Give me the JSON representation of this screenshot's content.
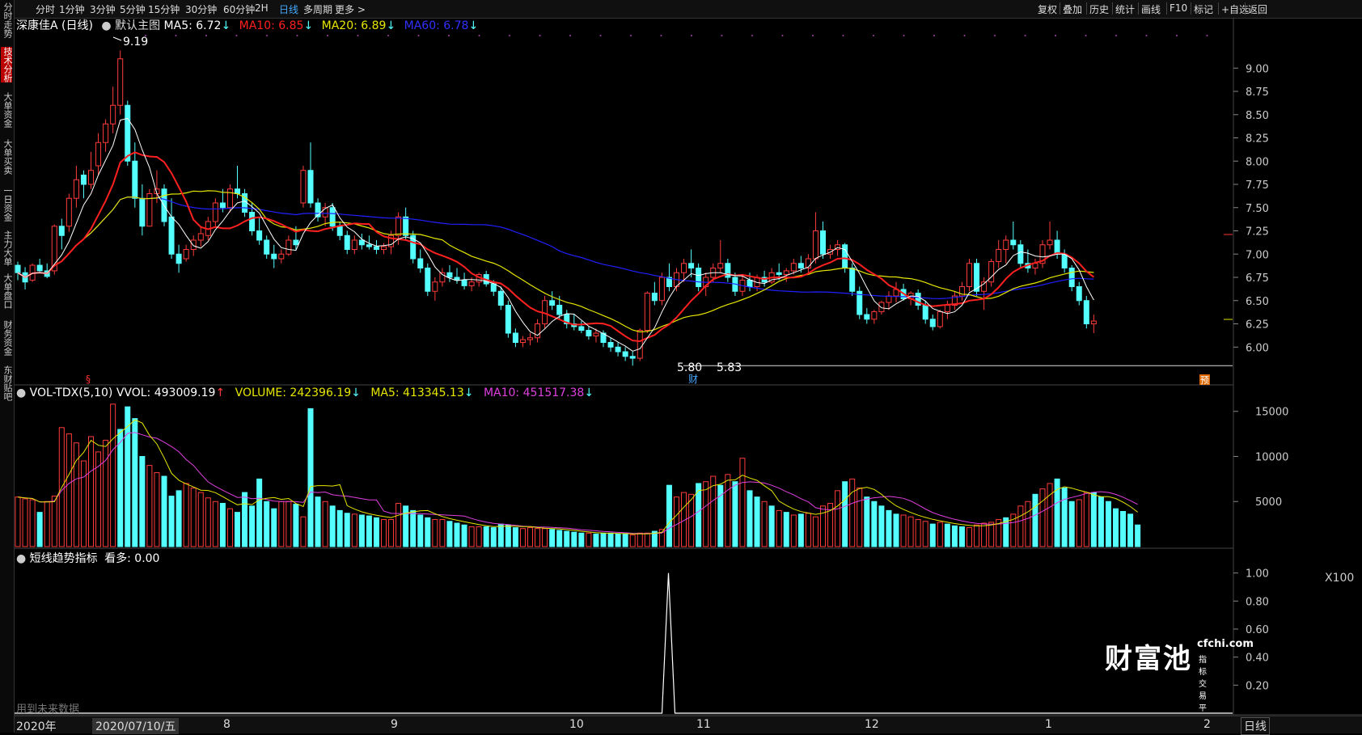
{
  "toolbar": {
    "left": [
      "分时",
      "1分钟",
      "3分钟",
      "5分钟",
      "15分钟",
      "30分钟",
      "60分钟",
      "2H",
      "日线",
      "多周期",
      "更多 >"
    ],
    "active": "日线",
    "right": [
      "复权",
      "叠加",
      "历史",
      "统计",
      "画线",
      "F10",
      "标记",
      "+自选",
      "返回"
    ]
  },
  "sidebar": [
    "分时走势",
    "技术分析",
    "大单资金",
    "大单买卖",
    "一日资金",
    "主力大单",
    "大单盘口",
    "财务资金",
    "东财贴吧"
  ],
  "sidebar_active": "技术分析",
  "main_header": {
    "stock": "深康佳A (日线)",
    "template": "默认主图",
    "ma5": "MA5: 6.72",
    "ma10": "MA10: 6.85",
    "ma20": "MA20: 6.89",
    "ma60": "MA60: 6.78",
    "arrow": "↓"
  },
  "vol_header": {
    "name": "VOL-TDX(5,10)",
    "vvol": "VVOL: 493009.19",
    "volume": "VOLUME: 242396.19",
    "ma5": "MA5: 413345.13",
    "ma10": "MA10: 451517.38",
    "up": "↑",
    "down": "↓"
  },
  "ind_header": {
    "name": "短线趋势指标",
    "value": "看多: 0.00"
  },
  "annotations": {
    "high": "9.19",
    "low_a": "5.80",
    "low_b": "5.83",
    "fin_marker": "财",
    "pre_marker": "预",
    "s_marker": "§",
    "future_data": "用到未来数据",
    "x100": "X100"
  },
  "x_axis": {
    "year": "2020年",
    "cursor_date": "2020/07/10/五",
    "months": [
      "8",
      "9",
      "10",
      "11",
      "12",
      "1",
      "2"
    ],
    "period_tab": "日线"
  },
  "logo": {
    "brand": "财富池",
    "site": "cfchi.com",
    "tagline": "指标交易平台"
  },
  "colors": {
    "up": "#ff3b3b",
    "down": "#54ffff",
    "ma5": "#ffffff",
    "ma10": "#ff2020",
    "ma20": "#e6e600",
    "ma60": "#2020ff",
    "vol_ma5": "#e6e600",
    "vol_ma10": "#e040e0"
  },
  "chart_data": [
    {
      "type": "candlestick",
      "name": "price",
      "y_ticks": [
        9.0,
        8.75,
        8.5,
        8.25,
        8.0,
        7.75,
        7.5,
        7.25,
        7.0,
        6.75,
        6.5,
        6.25,
        6.0
      ],
      "ylim": [
        5.75,
        9.35
      ],
      "reference_line": 5.8,
      "candles": [
        [
          6.88,
          6.92,
          6.72,
          6.8
        ],
        [
          6.8,
          6.86,
          6.62,
          6.7
        ],
        [
          6.72,
          6.9,
          6.7,
          6.88
        ],
        [
          6.88,
          6.95,
          6.8,
          6.82
        ],
        [
          6.82,
          6.9,
          6.74,
          6.76
        ],
        [
          6.82,
          7.32,
          6.78,
          7.3
        ],
        [
          7.3,
          7.38,
          7.05,
          7.2
        ],
        [
          7.3,
          7.65,
          7.24,
          7.6
        ],
        [
          7.6,
          7.95,
          7.5,
          7.8
        ],
        [
          7.85,
          7.9,
          7.6,
          7.75
        ],
        [
          7.75,
          8.1,
          7.7,
          7.9
        ],
        [
          7.95,
          8.3,
          7.85,
          8.2
        ],
        [
          8.2,
          8.45,
          8.1,
          8.4
        ],
        [
          8.4,
          8.8,
          8.3,
          8.6
        ],
        [
          8.6,
          9.19,
          8.5,
          9.1
        ],
        [
          8.6,
          8.65,
          7.95,
          8.0
        ],
        [
          8.0,
          8.2,
          7.5,
          7.6
        ],
        [
          7.6,
          7.75,
          7.2,
          7.3
        ],
        [
          7.3,
          7.7,
          7.3,
          7.65
        ],
        [
          7.65,
          7.9,
          7.55,
          7.7
        ],
        [
          7.7,
          7.75,
          7.3,
          7.35
        ],
        [
          7.4,
          7.6,
          6.95,
          7.0
        ],
        [
          7.0,
          7.1,
          6.8,
          6.9
        ],
        [
          6.95,
          7.1,
          6.92,
          7.05
        ],
        [
          7.05,
          7.2,
          6.98,
          7.15
        ],
        [
          7.15,
          7.3,
          7.08,
          7.22
        ],
        [
          7.2,
          7.4,
          7.15,
          7.35
        ],
        [
          7.35,
          7.6,
          7.3,
          7.55
        ],
        [
          7.55,
          7.7,
          7.45,
          7.5
        ],
        [
          7.5,
          7.75,
          7.45,
          7.7
        ],
        [
          7.7,
          7.95,
          7.6,
          7.65
        ],
        [
          7.65,
          7.7,
          7.4,
          7.45
        ],
        [
          7.45,
          7.55,
          7.2,
          7.25
        ],
        [
          7.25,
          7.4,
          7.1,
          7.15
        ],
        [
          7.15,
          7.2,
          6.95,
          7.0
        ],
        [
          7.0,
          7.1,
          6.85,
          6.95
        ],
        [
          6.95,
          7.05,
          6.9,
          7.0
        ],
        [
          7.0,
          7.2,
          6.98,
          7.15
        ],
        [
          7.15,
          7.3,
          7.05,
          7.1
        ],
        [
          7.55,
          7.95,
          7.5,
          7.9
        ],
        [
          7.9,
          8.2,
          7.5,
          7.55
        ],
        [
          7.55,
          7.6,
          7.35,
          7.4
        ],
        [
          7.4,
          7.55,
          7.3,
          7.5
        ],
        [
          7.5,
          7.55,
          7.25,
          7.3
        ],
        [
          7.3,
          7.35,
          7.15,
          7.2
        ],
        [
          7.2,
          7.25,
          7.0,
          7.05
        ],
        [
          7.05,
          7.2,
          7.0,
          7.15
        ],
        [
          7.15,
          7.22,
          7.05,
          7.1
        ],
        [
          7.1,
          7.2,
          7.05,
          7.08
        ],
        [
          7.08,
          7.15,
          7.0,
          7.05
        ],
        [
          7.05,
          7.12,
          7.0,
          7.08
        ],
        [
          7.08,
          7.25,
          7.0,
          7.2
        ],
        [
          7.2,
          7.45,
          7.1,
          7.4
        ],
        [
          7.4,
          7.5,
          7.15,
          7.2
        ],
        [
          7.2,
          7.25,
          6.9,
          6.95
        ],
        [
          6.95,
          7.05,
          6.8,
          6.85
        ],
        [
          6.85,
          6.9,
          6.55,
          6.6
        ],
        [
          6.6,
          6.75,
          6.5,
          6.7
        ],
        [
          6.7,
          6.85,
          6.65,
          6.8
        ],
        [
          6.8,
          6.88,
          6.7,
          6.75
        ],
        [
          6.75,
          6.85,
          6.68,
          6.72
        ],
        [
          6.72,
          6.8,
          6.62,
          6.66
        ],
        [
          6.66,
          6.75,
          6.6,
          6.7
        ],
        [
          6.7,
          6.8,
          6.65,
          6.78
        ],
        [
          6.78,
          6.82,
          6.65,
          6.68
        ],
        [
          6.68,
          6.72,
          6.55,
          6.6
        ],
        [
          6.6,
          6.65,
          6.4,
          6.45
        ],
        [
          6.45,
          6.5,
          6.1,
          6.15
        ],
        [
          6.15,
          6.2,
          6.0,
          6.05
        ],
        [
          6.05,
          6.12,
          6.0,
          6.08
        ],
        [
          6.08,
          6.15,
          6.02,
          6.1
        ],
        [
          6.1,
          6.3,
          6.05,
          6.25
        ],
        [
          6.25,
          6.55,
          6.2,
          6.5
        ],
        [
          6.5,
          6.6,
          6.4,
          6.45
        ],
        [
          6.45,
          6.55,
          6.3,
          6.35
        ],
        [
          6.35,
          6.4,
          6.2,
          6.25
        ],
        [
          6.25,
          6.35,
          6.18,
          6.22
        ],
        [
          6.22,
          6.28,
          6.15,
          6.18
        ],
        [
          6.18,
          6.22,
          6.08,
          6.12
        ],
        [
          6.12,
          6.2,
          6.05,
          6.15
        ],
        [
          6.15,
          6.18,
          6.0,
          6.05
        ],
        [
          6.05,
          6.1,
          5.95,
          6.0
        ],
        [
          6.0,
          6.05,
          5.9,
          5.95
        ],
        [
          5.95,
          6.0,
          5.85,
          5.9
        ],
        [
          5.9,
          5.95,
          5.8,
          5.88
        ],
        [
          5.88,
          6.2,
          5.85,
          6.18
        ],
        [
          6.18,
          6.6,
          6.15,
          6.58
        ],
        [
          6.58,
          6.7,
          6.45,
          6.5
        ],
        [
          6.5,
          6.8,
          6.45,
          6.75
        ],
        [
          6.75,
          6.9,
          6.6,
          6.65
        ],
        [
          6.65,
          6.85,
          6.6,
          6.8
        ],
        [
          6.8,
          6.95,
          6.7,
          6.9
        ],
        [
          6.9,
          7.05,
          6.75,
          6.85
        ],
        [
          6.85,
          6.9,
          6.6,
          6.65
        ],
        [
          6.65,
          6.8,
          6.55,
          6.75
        ],
        [
          6.75,
          6.9,
          6.7,
          6.85
        ],
        [
          6.85,
          7.15,
          6.8,
          6.9
        ],
        [
          6.9,
          6.95,
          6.7,
          6.75
        ],
        [
          6.75,
          6.8,
          6.55,
          6.6
        ],
        [
          6.6,
          6.78,
          6.55,
          6.72
        ],
        [
          6.72,
          6.8,
          6.6,
          6.65
        ],
        [
          6.65,
          6.78,
          6.6,
          6.75
        ],
        [
          6.75,
          6.82,
          6.65,
          6.7
        ],
        [
          6.7,
          6.85,
          6.68,
          6.8
        ],
        [
          6.8,
          6.9,
          6.72,
          6.78
        ],
        [
          6.78,
          6.85,
          6.7,
          6.82
        ],
        [
          6.82,
          6.95,
          6.78,
          6.9
        ],
        [
          6.9,
          6.98,
          6.8,
          6.85
        ],
        [
          6.85,
          7.0,
          6.8,
          6.95
        ],
        [
          6.95,
          7.45,
          6.9,
          7.25
        ],
        [
          7.25,
          7.35,
          6.95,
          7.0
        ],
        [
          7.0,
          7.1,
          6.95,
          7.05
        ],
        [
          7.05,
          7.15,
          6.98,
          7.1
        ],
        [
          7.1,
          7.12,
          6.8,
          6.85
        ],
        [
          6.85,
          6.9,
          6.55,
          6.6
        ],
        [
          6.6,
          6.65,
          6.3,
          6.35
        ],
        [
          6.35,
          6.42,
          6.25,
          6.3
        ],
        [
          6.3,
          6.4,
          6.25,
          6.38
        ],
        [
          6.38,
          6.5,
          6.35,
          6.48
        ],
        [
          6.48,
          6.6,
          6.4,
          6.55
        ],
        [
          6.55,
          6.7,
          6.48,
          6.62
        ],
        [
          6.62,
          6.68,
          6.5,
          6.52
        ],
        [
          6.52,
          6.6,
          6.45,
          6.58
        ],
        [
          6.58,
          6.62,
          6.4,
          6.45
        ],
        [
          6.45,
          6.5,
          6.25,
          6.3
        ],
        [
          6.3,
          6.35,
          6.18,
          6.22
        ],
        [
          6.22,
          6.4,
          6.2,
          6.38
        ],
        [
          6.38,
          6.5,
          6.3,
          6.45
        ],
        [
          6.45,
          6.6,
          6.4,
          6.55
        ],
        [
          6.55,
          6.7,
          6.5,
          6.65
        ],
        [
          6.65,
          6.95,
          6.6,
          6.9
        ],
        [
          6.9,
          6.95,
          6.55,
          6.6
        ],
        [
          6.6,
          6.75,
          6.4,
          6.7
        ],
        [
          6.7,
          6.95,
          6.65,
          6.92
        ],
        [
          6.92,
          7.15,
          6.85,
          7.05
        ],
        [
          7.05,
          7.2,
          6.9,
          7.15
        ],
        [
          7.15,
          7.35,
          7.05,
          7.1
        ],
        [
          7.1,
          7.15,
          6.85,
          6.9
        ],
        [
          6.9,
          7.05,
          6.8,
          6.85
        ],
        [
          6.85,
          6.95,
          6.78,
          6.9
        ],
        [
          6.9,
          7.15,
          6.85,
          7.1
        ],
        [
          7.1,
          7.35,
          7.05,
          7.15
        ],
        [
          7.15,
          7.25,
          6.95,
          7.0
        ],
        [
          7.0,
          7.05,
          6.8,
          6.85
        ],
        [
          6.85,
          6.88,
          6.6,
          6.65
        ],
        [
          6.65,
          6.7,
          6.45,
          6.5
        ],
        [
          6.5,
          6.55,
          6.2,
          6.25
        ],
        [
          6.25,
          6.35,
          6.15,
          6.28
        ]
      ]
    },
    {
      "type": "bar",
      "name": "volume",
      "unit": "X100",
      "y_ticks": [
        15000,
        10000,
        5000
      ],
      "ylim": [
        0,
        16500
      ],
      "values": [
        5500,
        5300,
        5200,
        3800,
        5000,
        5600,
        13200,
        12500,
        11500,
        9500,
        12200,
        10500,
        11800,
        15800,
        13000,
        15500,
        14200,
        10000,
        9000,
        8200,
        7800,
        5600,
        6200,
        7000,
        6500,
        6000,
        5400,
        5000,
        4800,
        4200,
        3800,
        6000,
        4500,
        7500,
        5000,
        4200,
        5000,
        5000,
        4700,
        3300,
        15300,
        5500,
        5000,
        4500,
        4000,
        3700,
        3600,
        3500,
        3400,
        3200,
        3000,
        3000,
        4800,
        4500,
        4000,
        3500,
        3200,
        3000,
        3000,
        2800,
        2600,
        2400,
        2200,
        2200,
        2200,
        2100,
        2500,
        2400,
        2100,
        2000,
        2100,
        2000,
        2000,
        1900,
        1800,
        1700,
        1600,
        1500,
        1500,
        1400,
        1500,
        1500,
        1400,
        1400,
        1300,
        1500,
        1500,
        1700,
        1900,
        6800,
        5500,
        6000,
        5800,
        7000,
        7200,
        7800,
        6800,
        8000,
        7200,
        9800,
        6200,
        5500,
        5000,
        4500,
        4000,
        3800,
        3500,
        3600,
        3700,
        3300,
        4500,
        4800,
        6200,
        7200,
        7500,
        6500,
        5500,
        5000,
        4500,
        4000,
        3600,
        3500,
        3300,
        3000,
        2800,
        2500,
        2700,
        2500,
        2300,
        2200,
        2100,
        2400,
        2600,
        2700,
        3000,
        3200,
        3600,
        4500,
        5000,
        5800,
        6400,
        7000,
        7500,
        6500,
        5000,
        5200,
        6000,
        6000,
        5500,
        5000,
        4200,
        3900,
        3600,
        2400
      ],
      "up_flags": [
        1,
        1,
        1,
        0,
        1,
        1,
        1,
        1,
        1,
        1,
        1,
        1,
        1,
        1,
        0,
        0,
        0,
        0,
        1,
        1,
        0,
        0,
        0,
        1,
        1,
        1,
        1,
        1,
        0,
        1,
        0,
        0,
        0,
        0,
        0,
        0,
        1,
        1,
        0,
        1,
        0,
        0,
        1,
        0,
        0,
        0,
        1,
        0,
        0,
        0,
        1,
        1,
        1,
        0,
        0,
        0,
        0,
        1,
        1,
        0,
        0,
        0,
        1,
        1,
        0,
        0,
        0,
        0,
        0,
        1,
        1,
        1,
        1,
        0,
        0,
        0,
        0,
        0,
        1,
        0,
        0,
        0,
        0,
        0,
        1,
        1,
        1,
        0,
        1,
        0,
        1,
        1,
        1,
        0,
        1,
        1,
        0,
        1,
        0,
        1,
        0,
        0,
        1,
        0,
        1,
        0,
        1,
        0,
        1,
        1,
        1,
        1,
        1,
        0,
        1,
        1,
        0,
        0,
        0,
        0,
        0,
        1,
        1,
        1,
        1,
        0,
        1,
        0,
        0,
        0,
        1,
        1,
        1,
        1,
        1,
        0,
        1,
        1,
        1,
        0,
        1,
        1,
        0,
        0,
        0,
        1,
        1,
        0,
        0,
        0,
        0,
        0,
        0,
        0
      ]
    },
    {
      "type": "line",
      "name": "短线趋势指标",
      "y_ticks": [
        1.0,
        0.8,
        0.6,
        0.4,
        0.2
      ],
      "ylim": [
        0,
        1.05
      ],
      "spike_index": 90,
      "spike_value": 1.0
    }
  ]
}
